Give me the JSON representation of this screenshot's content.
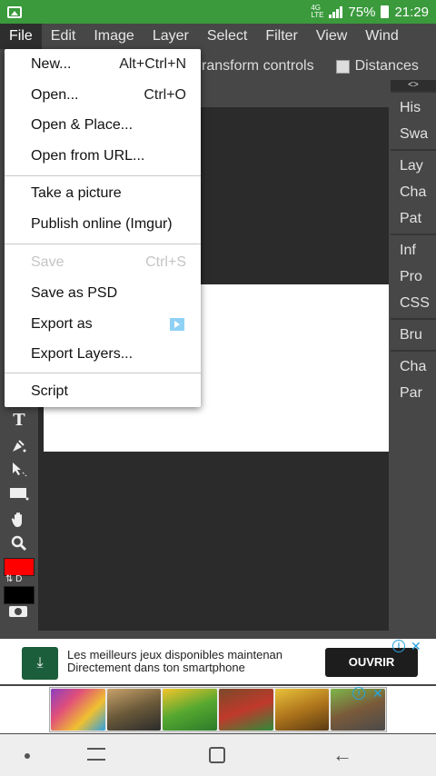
{
  "status_bar": {
    "network": "4G",
    "network_sub": "LTE",
    "battery": "75%",
    "time": "21:29"
  },
  "menubar": {
    "items": [
      "File",
      "Edit",
      "Image",
      "Layer",
      "Select",
      "Filter",
      "View",
      "Wind"
    ]
  },
  "options_bar": {
    "transform_label": "ransform controls",
    "distances_label": "Distances"
  },
  "file_menu": {
    "new": {
      "label": "New...",
      "shortcut": "Alt+Ctrl+N"
    },
    "open": {
      "label": "Open...",
      "shortcut": "Ctrl+O"
    },
    "open_place": {
      "label": "Open & Place..."
    },
    "open_url": {
      "label": "Open from URL..."
    },
    "take_picture": {
      "label": "Take a picture"
    },
    "publish": {
      "label": "Publish online (Imgur)"
    },
    "save": {
      "label": "Save",
      "shortcut": "Ctrl+S",
      "disabled": true
    },
    "save_psd": {
      "label": "Save as PSD"
    },
    "export_as": {
      "label": "Export as"
    },
    "export_layers": {
      "label": "Export Layers..."
    },
    "script": {
      "label": "Script"
    }
  },
  "right_panel": {
    "arrows": "<>",
    "group1": [
      "His",
      "Swa"
    ],
    "group2": [
      "Lay",
      "Cha",
      "Pat"
    ],
    "group3": [
      "Inf",
      "Pro",
      "CSS"
    ],
    "group4": [
      "Bru"
    ],
    "group5": [
      "Cha",
      "Par"
    ]
  },
  "toolbar": {
    "text_tool": "T",
    "swap_label": "⇅ D"
  },
  "colors": {
    "foreground": "#ff0000",
    "background": "#000000",
    "status_bar": "#3a9a3c"
  },
  "ad1": {
    "line1": "Les meilleurs jeux disponibles maintenan",
    "line2": "Directement dans ton smartphone",
    "cta": "OUVRIR"
  },
  "ad2": {
    "games": [
      "match-3 game",
      "grand theft auto",
      "crocodile game",
      "fruit ninja",
      "temple run",
      "minecraft"
    ]
  }
}
